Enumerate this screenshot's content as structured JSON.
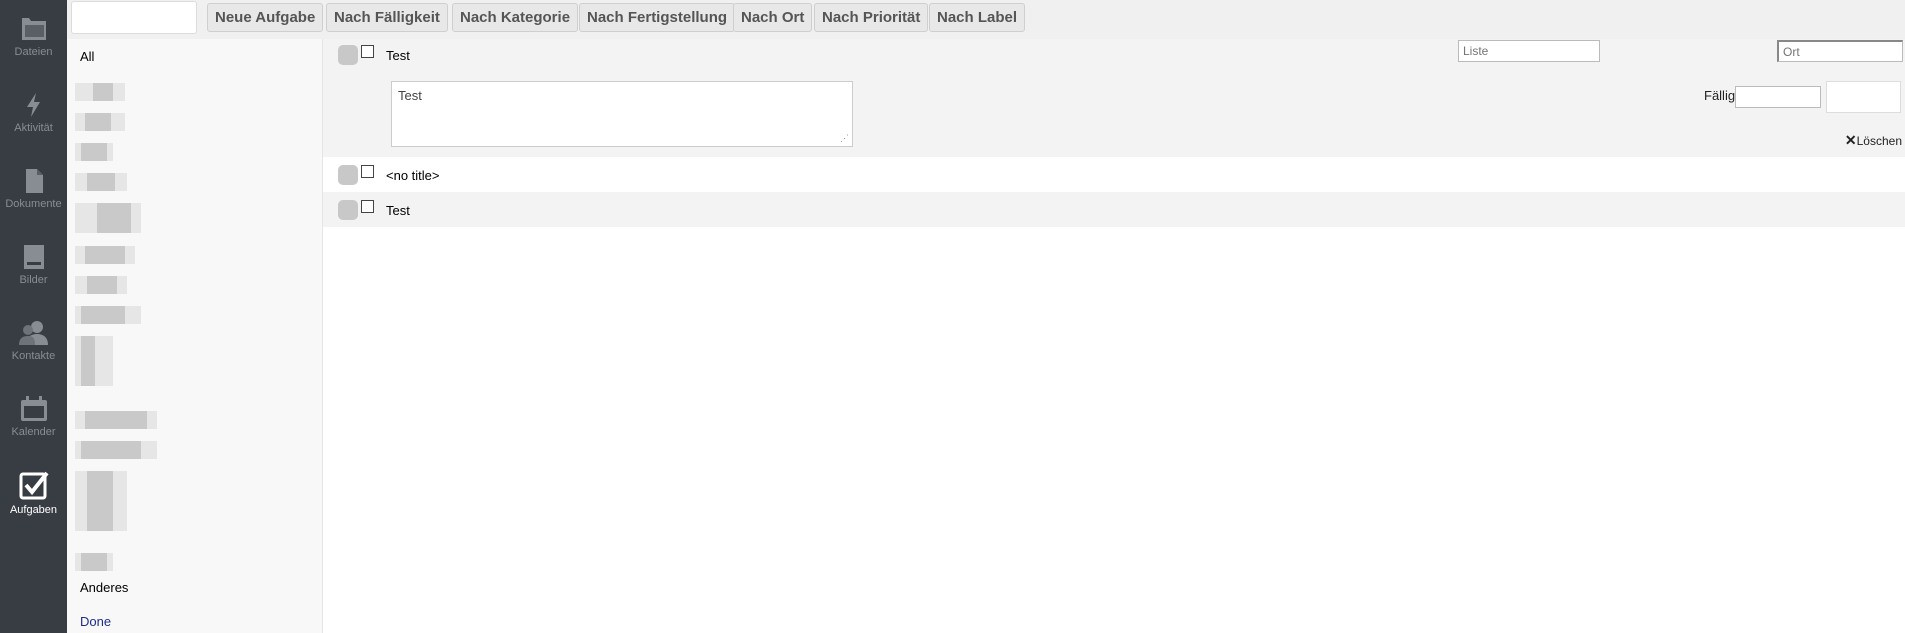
{
  "nav": [
    {
      "label": "Dateien",
      "icon": "folder-icon",
      "active": false
    },
    {
      "label": "Aktivität",
      "icon": "lightning-icon",
      "active": false
    },
    {
      "label": "Dokumente",
      "icon": "document-icon",
      "active": false
    },
    {
      "label": "Bilder",
      "icon": "image-icon",
      "active": false
    },
    {
      "label": "Kontakte",
      "icon": "contacts-icon",
      "active": false
    },
    {
      "label": "Kalender",
      "icon": "calendar-icon",
      "active": false
    },
    {
      "label": "Aufgaben",
      "icon": "checkbox-icon",
      "active": true
    }
  ],
  "toolbar": {
    "search_value": "",
    "buttons": [
      "Neue Aufgabe",
      "Nach Fälligkeit",
      "Nach Kategorie",
      "Nach Fertigstellung",
      "Nach Ort",
      "Nach Priorität",
      "Nach Label"
    ]
  },
  "categories": {
    "all": "All",
    "other": "Anderes",
    "done": "Done"
  },
  "tasks": [
    {
      "title": "Test",
      "expanded": true,
      "notes": "Test",
      "list_placeholder": "Liste",
      "location_placeholder": "Ort",
      "due_label": "Fällig",
      "due_date_value": "",
      "due_time_value": "",
      "delete_label": "Löschen"
    },
    {
      "title": "<no title>",
      "expanded": false
    },
    {
      "title": "Test",
      "expanded": false
    }
  ],
  "colors": {
    "nav_bg": "#383c43",
    "nav_text": "#888d93",
    "nav_active": "#ffffff",
    "toolbar_bg": "#f0f0f0",
    "sidebar_bg": "#f8f8f8",
    "row_alt": "#f3f3f3",
    "link_done": "#1d2d8a"
  }
}
